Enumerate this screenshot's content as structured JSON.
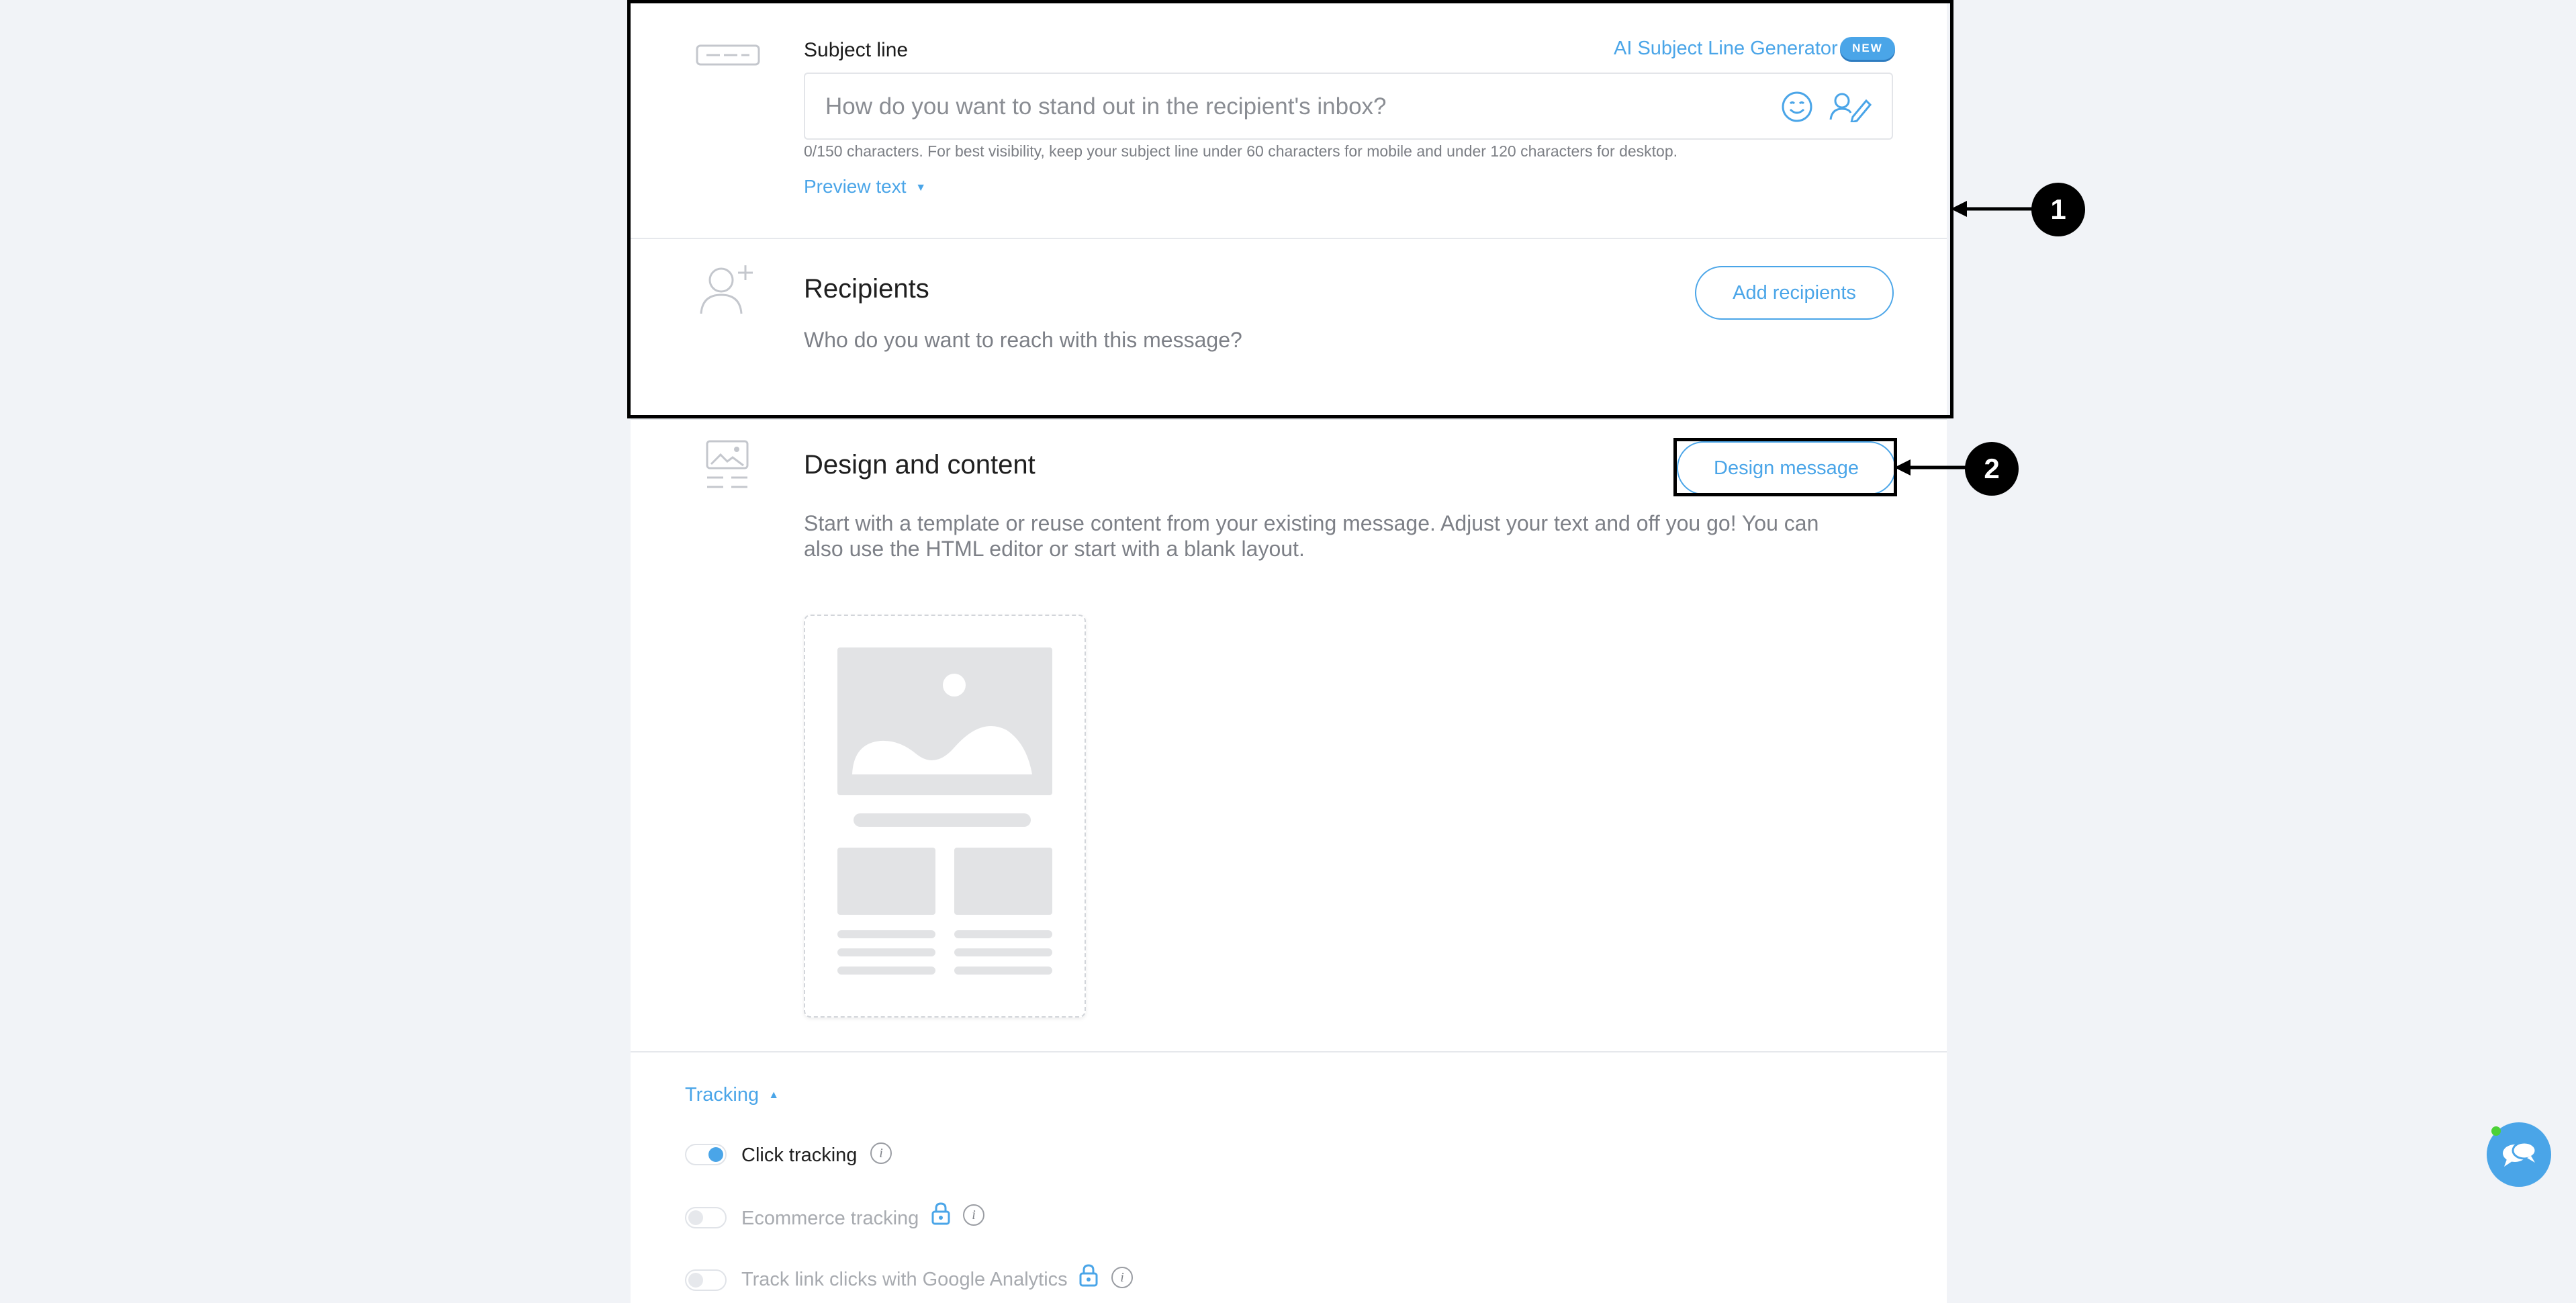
{
  "subject": {
    "label": "Subject line",
    "ai_generator_link": "AI Subject Line Generator",
    "new_badge": "NEW",
    "placeholder": "How do you want to stand out in the recipient's inbox?",
    "hint": "0/150 characters. For best visibility, keep your subject line under 60 characters for mobile and under 120 characters for desktop.",
    "preview_text_toggle": "Preview text",
    "icons": [
      "subject-line-icon",
      "emoji-icon",
      "personalize-icon"
    ]
  },
  "recipients": {
    "title": "Recipients",
    "description": "Who do you want to reach with this message?",
    "button": "Add recipients",
    "icon": "add-user-icon"
  },
  "design": {
    "title": "Design and content",
    "description_line1": "Start with a template or reuse content from your existing message. Adjust your text and off you go! You can",
    "description_line2": "also use the HTML editor or start with a blank layout.",
    "button": "Design message",
    "icon": "design-layout-icon"
  },
  "tracking": {
    "toggle": "Tracking",
    "items": [
      {
        "label": "Click tracking",
        "enabled": true,
        "locked": false
      },
      {
        "label": "Ecommerce tracking",
        "enabled": false,
        "locked": true
      },
      {
        "label": "Track link clicks with Google Analytics",
        "enabled": false,
        "locked": true
      }
    ]
  },
  "callouts": {
    "one": "1",
    "two": "2"
  },
  "colors": {
    "accent": "#4aa5e8",
    "background": "#f1f3f7",
    "panel": "#ffffff"
  }
}
